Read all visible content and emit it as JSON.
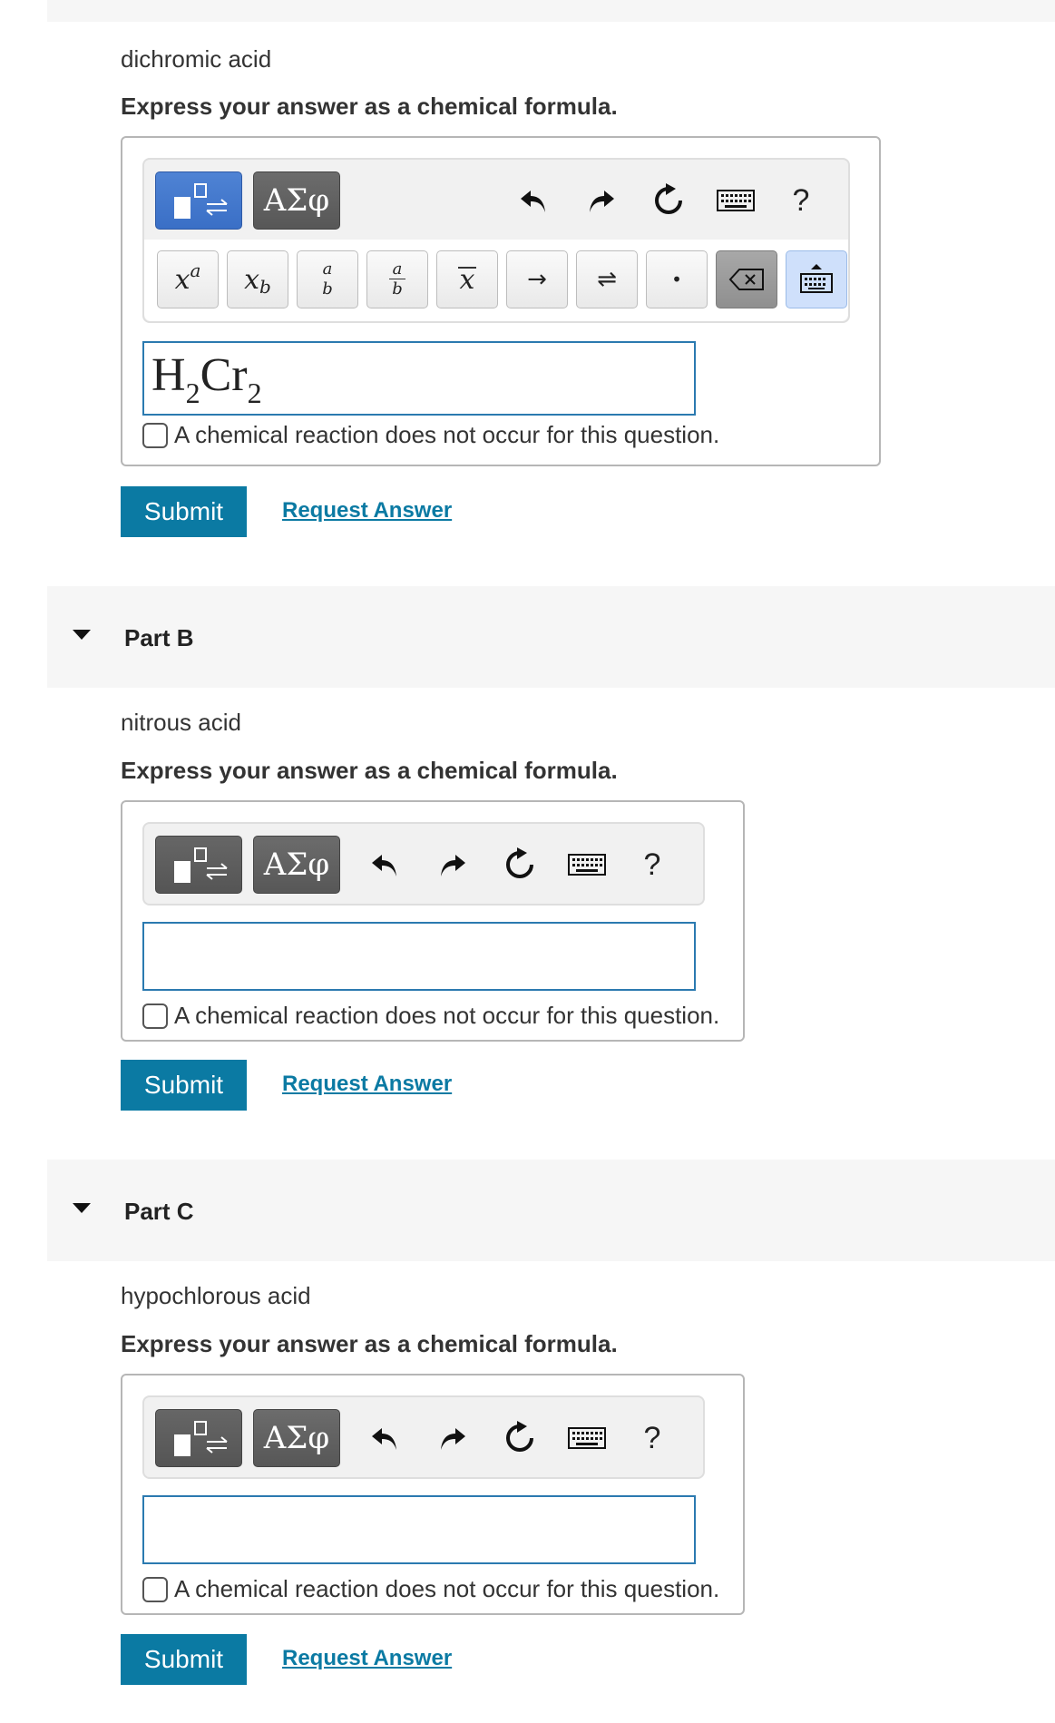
{
  "part_a": {
    "question": "dichromic acid",
    "instruction": "Express your answer as a chemical formula.",
    "toolbar": {
      "greek_label": "ΑΣφ",
      "help_label": "?",
      "keys": {
        "superscript_base": "x",
        "superscript_exp": "a",
        "subscript_base": "x",
        "subscript_sub": "b",
        "frac_num": "a",
        "frac_den": "b",
        "mixed_num": "a",
        "mixed_den": "b",
        "vector": "x",
        "arrow": "→",
        "equilibrium": "⇌",
        "dot": "•"
      }
    },
    "answer": {
      "h": "H",
      "h_sub": "2",
      "cr": "Cr",
      "cr_sub": "2"
    },
    "no_reaction_label": "A chemical reaction does not occur for this question.",
    "submit_label": "Submit",
    "request_label": "Request Answer"
  },
  "part_b": {
    "title": "Part B",
    "question": "nitrous acid",
    "instruction": "Express your answer as a chemical formula.",
    "greek_label": "ΑΣφ",
    "help_label": "?",
    "answer_value": "",
    "no_reaction_label": "A chemical reaction does not occur for this question.",
    "submit_label": "Submit",
    "request_label": "Request Answer"
  },
  "part_c": {
    "title": "Part C",
    "question": "hypochlorous acid",
    "instruction": "Express your answer as a chemical formula.",
    "greek_label": "ΑΣφ",
    "help_label": "?",
    "answer_value": "",
    "no_reaction_label": "A chemical reaction does not occur for this question.",
    "submit_label": "Submit",
    "request_label": "Request Answer"
  },
  "colors": {
    "accent": "#0b7aa3",
    "template_active": "#3a6fc6",
    "panel_bg": "#f6f6f6"
  }
}
